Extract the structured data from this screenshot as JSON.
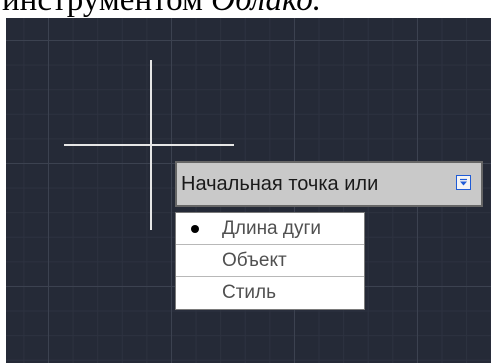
{
  "document": {
    "heading_prefix": "инструментом ",
    "heading_italic": "Облако."
  },
  "prompt": {
    "text": "Начальная точка или",
    "dropdown_icon": "dropdown-arrow-icon"
  },
  "options": [
    {
      "label": "Длина дуги",
      "selected": true
    },
    {
      "label": "Объект",
      "selected": false
    },
    {
      "label": "Стиль",
      "selected": false
    }
  ],
  "colors": {
    "canvas_background": "#252a37",
    "crosshair": "#e6e6e6",
    "prompt_background": "#c9c9c9",
    "icon_accent": "#1f5bd6"
  }
}
